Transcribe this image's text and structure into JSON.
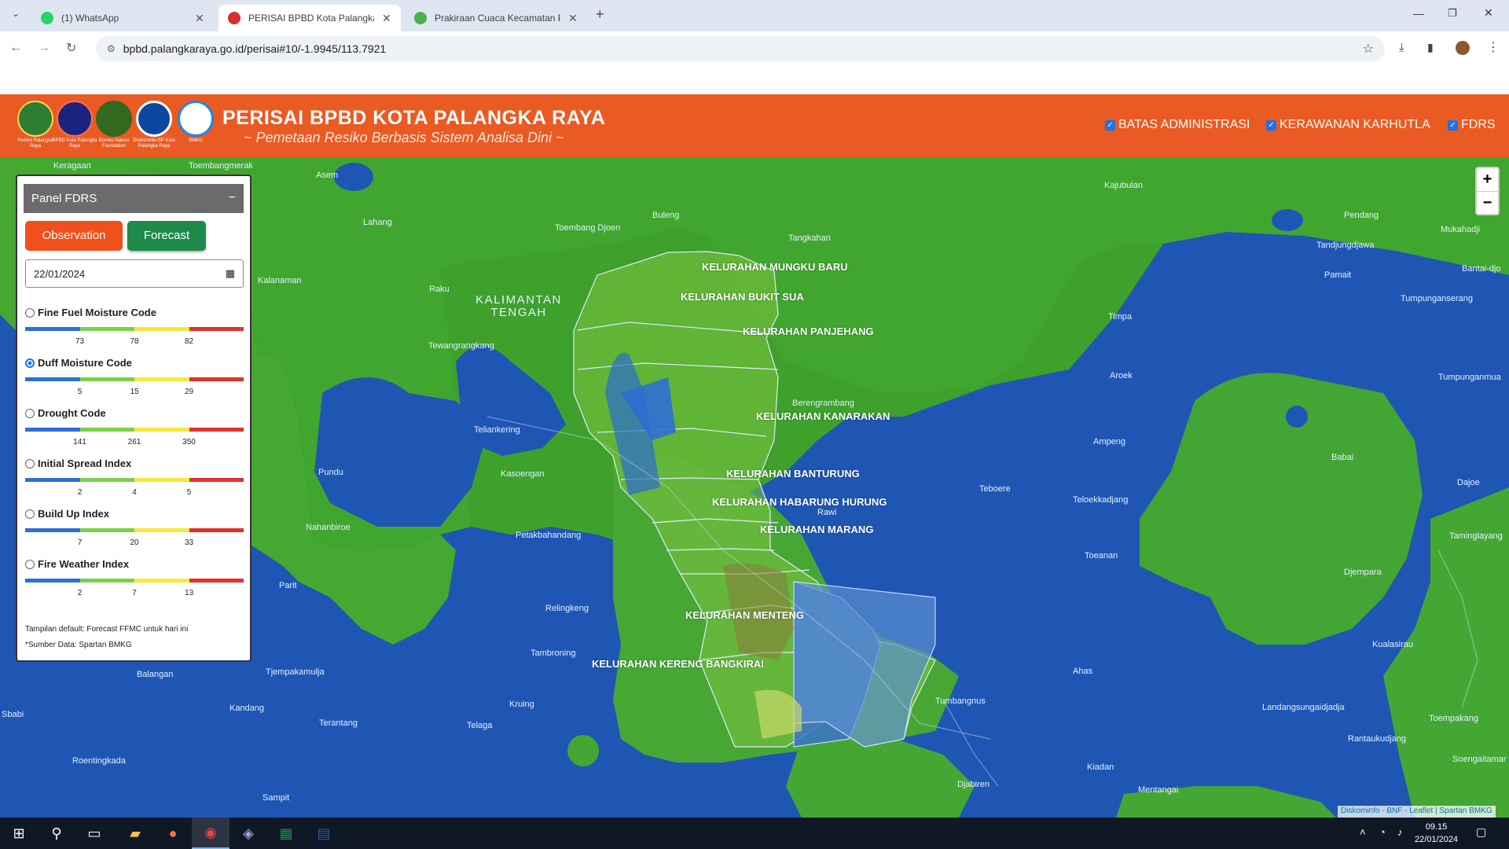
{
  "browser": {
    "tabs": [
      {
        "title": "(1) WhatsApp",
        "favicon": "whatsapp-icon",
        "color": "#25d366"
      },
      {
        "title": "PERISAI BPBD Kota Palangka Ra",
        "favicon": "bpbd-icon",
        "color": "#d32f2f"
      },
      {
        "title": "Prakiraan Cuaca Kecamatan Pa",
        "favicon": "bmkg-icon",
        "color": "#4caf50"
      }
    ],
    "url": "bpbd.palangkaraya.go.id/perisai#10/-1.9945/113.7921"
  },
  "header": {
    "title": "PERISAI BPBD KOTA PALANGKA RAYA",
    "subtitle": "~ Pemetaan Resiko Berbasis Sistem Analisa Dini ~",
    "logos": [
      {
        "caption": "Pemko Palangka Raya"
      },
      {
        "caption": "BPBD Kota Palangka Raya"
      },
      {
        "caption": "Borneo Nature Foundation"
      },
      {
        "caption": "Diskominfo-SP Kota Palangka Raya"
      },
      {
        "caption": "BMKG"
      }
    ],
    "layers": [
      {
        "label": "BATAS ADMINISTRASI",
        "checked": true
      },
      {
        "label": "KERAWANAN KARHUTLA",
        "checked": true
      },
      {
        "label": "FDRS",
        "checked": true
      }
    ]
  },
  "panel": {
    "title": "Panel FDRS",
    "minimize": "−",
    "observation_label": "Observation",
    "forecast_label": "Forecast",
    "date_value": "22/01/2024",
    "scale_colors": [
      "#2f6fd6",
      "#7ad24a",
      "#f3ea3a",
      "#e0322c"
    ],
    "indices": [
      {
        "label": "Fine Fuel Moisture Code",
        "selected": false,
        "ticks": [
          "73",
          "78",
          "82"
        ]
      },
      {
        "label": "Duff Moisture Code",
        "selected": true,
        "ticks": [
          "5",
          "15",
          "29"
        ]
      },
      {
        "label": "Drought Code",
        "selected": false,
        "ticks": [
          "141",
          "261",
          "350"
        ]
      },
      {
        "label": "Initial Spread Index",
        "selected": false,
        "ticks": [
          "2",
          "4",
          "5"
        ]
      },
      {
        "label": "Build Up Index",
        "selected": false,
        "ticks": [
          "7",
          "20",
          "33"
        ]
      },
      {
        "label": "Fire Weather Index",
        "selected": false,
        "ticks": [
          "2",
          "7",
          "13"
        ]
      }
    ],
    "note_default": "Tampilan default: Forecast FFMC untuk hari ini",
    "note_source": "*Sumber Data: Spartan BMKG"
  },
  "map": {
    "zoom_in": "+",
    "zoom_out": "−",
    "attribution": "Diskominfo - BNF - Leaflet | Spartan BMKG",
    "region_label": "KALIMANTAN TENGAH",
    "places": [
      "Keragaan",
      "Toembangmerak",
      "Asem",
      "Lahang",
      "Kalanaman",
      "Raku",
      "Tewangrangkang",
      "Teliankering",
      "Pundu",
      "Kasoengan",
      "Nahanbiroe",
      "Petakbahandang",
      "Parit",
      "Relingkeng",
      "Tambroning",
      "Tjempakamulja",
      "Balangan",
      "Kandang",
      "Sbabi",
      "Terantang",
      "Telaga",
      "Kruing",
      "Roentingkada",
      "Sampit",
      "Buleng",
      "Toembang Djoen",
      "Tangkahan",
      "Berengrambang",
      "Rawi",
      "Kajubulan",
      "Timpa",
      "Aroek",
      "Ampeng",
      "Teboere",
      "Teloekkadjang",
      "Toeanan",
      "Ahas",
      "Tumbangnus",
      "Kiadan",
      "Djabiren",
      "Mentangai",
      "Pendang",
      "Mukahadji",
      "Tandjungdjawa",
      "Pamait",
      "Bantai-djo",
      "Tumpunganserang",
      "Tumpunganmua",
      "Babai",
      "Dajoe",
      "Taminglayang",
      "Djempara",
      "Kualasirau",
      "Landangsungaidjadja",
      "Toempakang",
      "Rantaukudjang",
      "Soengaitamar"
    ],
    "kelurahan": [
      "KELURAHAN MUNGKU BARU",
      "KELURAHAN BUKIT SUA",
      "KELURAHAN PANJEHANG",
      "KELURAHAN KANARAKAN",
      "KELURAHAN BANTURUNG",
      "KELURAHAN HABARUNG HURUNG",
      "KELURAHAN MARANG",
      "KELURAHAN MENTENG",
      "KELURAHAN KERENG BANGKIRAI"
    ]
  },
  "taskbar": {
    "time": "09.15",
    "date": "22/01/2024"
  }
}
